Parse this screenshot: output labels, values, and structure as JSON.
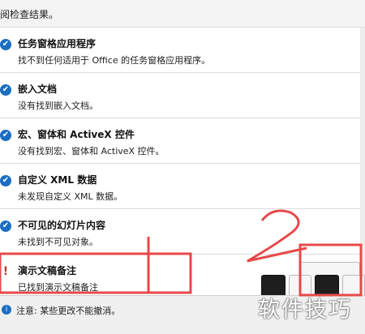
{
  "header": {
    "text": "阅检查结果。"
  },
  "items": [
    {
      "status": "ok",
      "title": "任务窗格应用程序",
      "desc": "找不到任何适用于 Office 的任务窗格应用程序。"
    },
    {
      "status": "ok",
      "title": "嵌入文档",
      "desc": "没有找到嵌入文档。"
    },
    {
      "status": "ok",
      "title": "宏、窗体和 ActiveX 控件",
      "desc": "没有找到宏、窗体和 ActiveX 控件。"
    },
    {
      "status": "ok",
      "title": "自定义 XML 数据",
      "desc": "未发现自定义 XML 数据。"
    },
    {
      "status": "ok",
      "title": "不可见的幻灯片内容",
      "desc": "未找到不可见对象。"
    },
    {
      "status": "warn",
      "title": "演示文稿备注",
      "desc": "已找到演示文稿备注"
    }
  ],
  "footer": {
    "note": "注意: 某些更改不能撤消。"
  },
  "annotations": {
    "label1": "1",
    "label2": "2",
    "color": "#e8484a"
  },
  "watermark": "软件技巧",
  "colors": {
    "accent": "#1b6ec2",
    "warning": "#c0392b"
  },
  "icons": {
    "ok": "check-circle-icon",
    "warn": "exclamation-icon",
    "info": "info-icon"
  }
}
